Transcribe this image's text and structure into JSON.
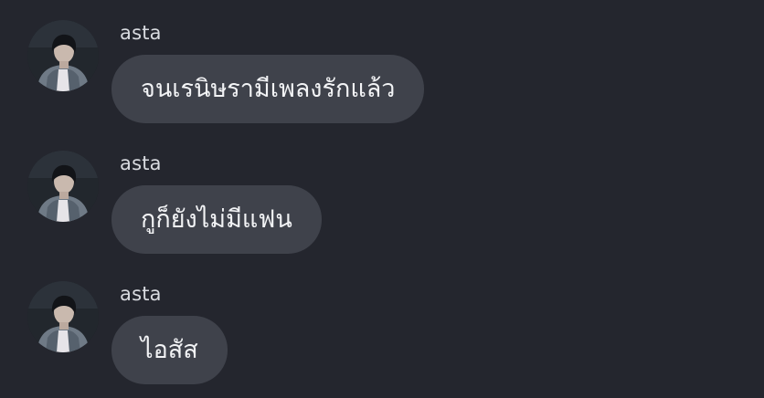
{
  "chat": {
    "messages": [
      {
        "username": "asta",
        "text": "จนเรนิษรามีเพลงรักแล้ว",
        "avatar_icon": "user-avatar"
      },
      {
        "username": "asta",
        "text": "กูก็ยังไม่มีแฟน",
        "avatar_icon": "user-avatar"
      },
      {
        "username": "asta",
        "text": "ไอสัส",
        "avatar_icon": "user-avatar"
      }
    ]
  },
  "colors": {
    "background": "#24262e",
    "bubble": "#3f424b",
    "username": "#d9dbe0",
    "message_text": "#f2f3f5"
  }
}
